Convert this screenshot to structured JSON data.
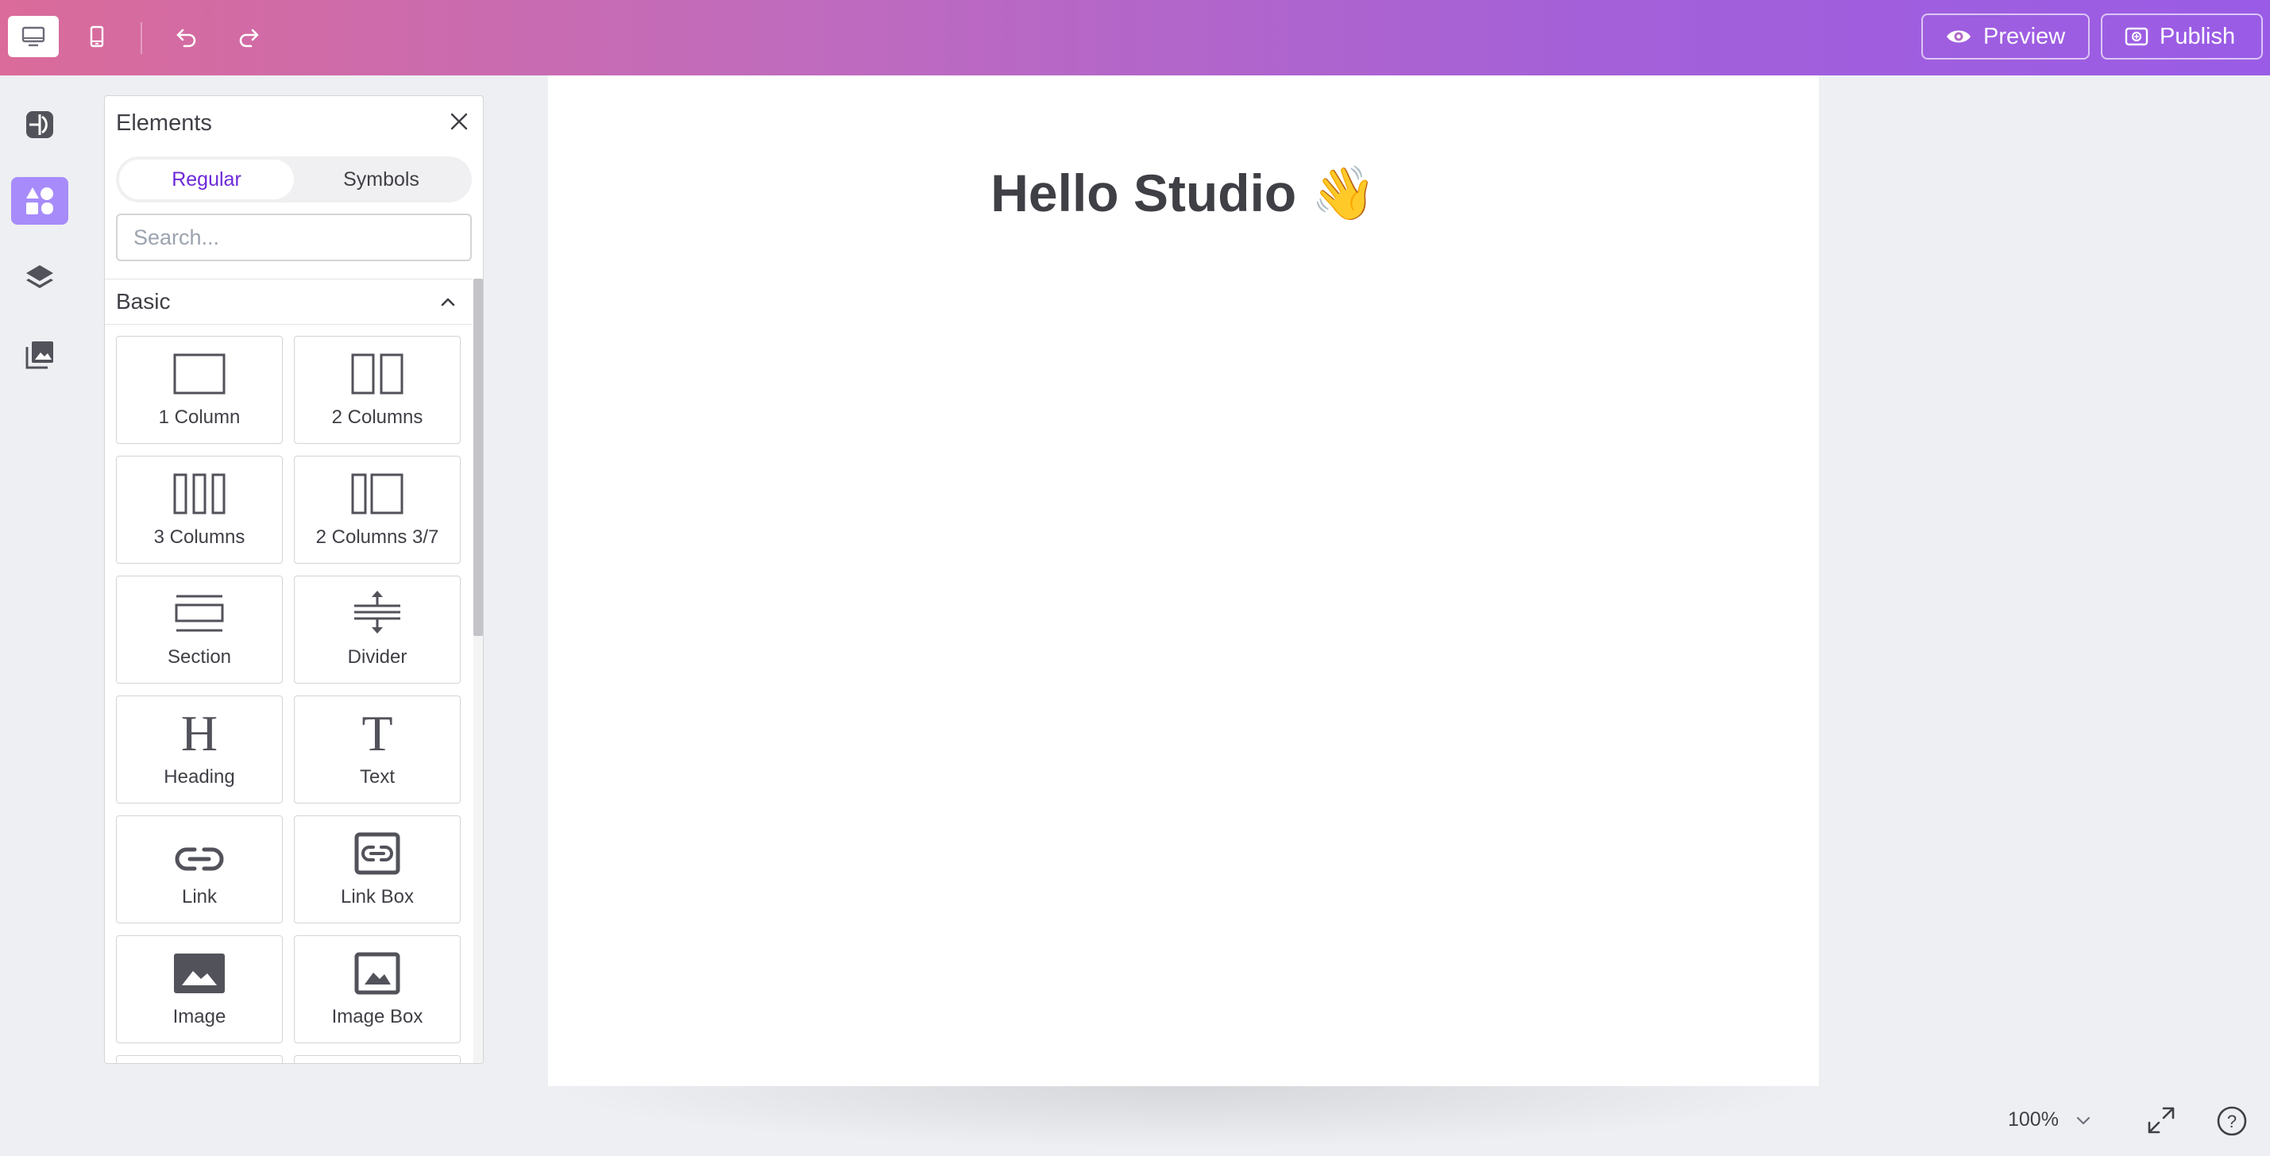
{
  "toolbar": {
    "preview_label": "Preview",
    "publish_label": "Publish",
    "icons": [
      "desktop-icon",
      "mobile-icon",
      "undo-icon",
      "redo-icon"
    ]
  },
  "sidebar_rail": {
    "items": [
      "styles-icon",
      "elements-icon",
      "layers-icon",
      "assets-icon"
    ],
    "active": "elements-icon"
  },
  "panel": {
    "title": "Elements",
    "tabs": [
      {
        "label": "Regular",
        "active": true
      },
      {
        "label": "Symbols",
        "active": false
      }
    ],
    "search_placeholder": "Search...",
    "category": "Basic",
    "tiles": [
      {
        "label": "1 Column",
        "icon": "one-column-icon"
      },
      {
        "label": "2 Columns",
        "icon": "two-columns-icon"
      },
      {
        "label": "3 Columns",
        "icon": "three-columns-icon"
      },
      {
        "label": "2 Columns 3/7",
        "icon": "two-columns-3-7-icon"
      },
      {
        "label": "Section",
        "icon": "section-icon"
      },
      {
        "label": "Divider",
        "icon": "divider-icon"
      },
      {
        "label": "Heading",
        "icon": "heading-icon"
      },
      {
        "label": "Text",
        "icon": "text-icon"
      },
      {
        "label": "Link",
        "icon": "link-icon"
      },
      {
        "label": "Link Box",
        "icon": "link-box-icon"
      },
      {
        "label": "Image",
        "icon": "image-icon"
      },
      {
        "label": "Image Box",
        "icon": "image-box-icon"
      }
    ]
  },
  "canvas": {
    "heading": "Hello Studio 👋"
  },
  "footer": {
    "zoom": "100%"
  },
  "colors": {
    "accent": "#6d28d9",
    "rail_active": "#a78bfa",
    "gradient_start": "#da6b9a",
    "gradient_end": "#9a5ce6"
  }
}
